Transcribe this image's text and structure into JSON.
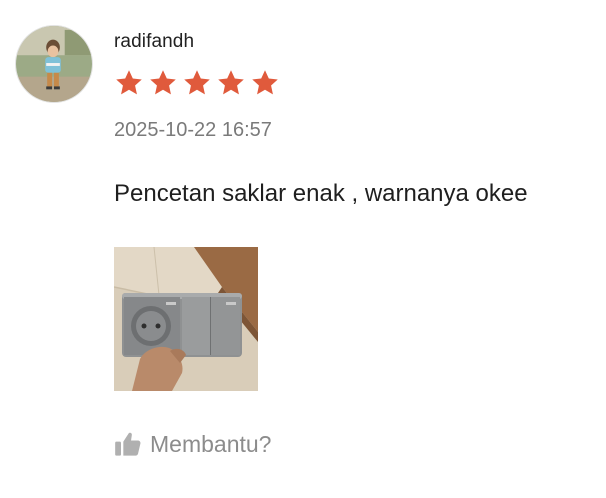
{
  "review": {
    "username": "radifandh",
    "rating": 5,
    "rating_max": 5,
    "star_color": "#e05a3c",
    "timestamp": "2025-10-22 16:57",
    "comment": "Pencetan saklar enak , warnanya okee",
    "helpful_label": "Membantu?",
    "helpful_icon": "thumbs-up-icon"
  }
}
